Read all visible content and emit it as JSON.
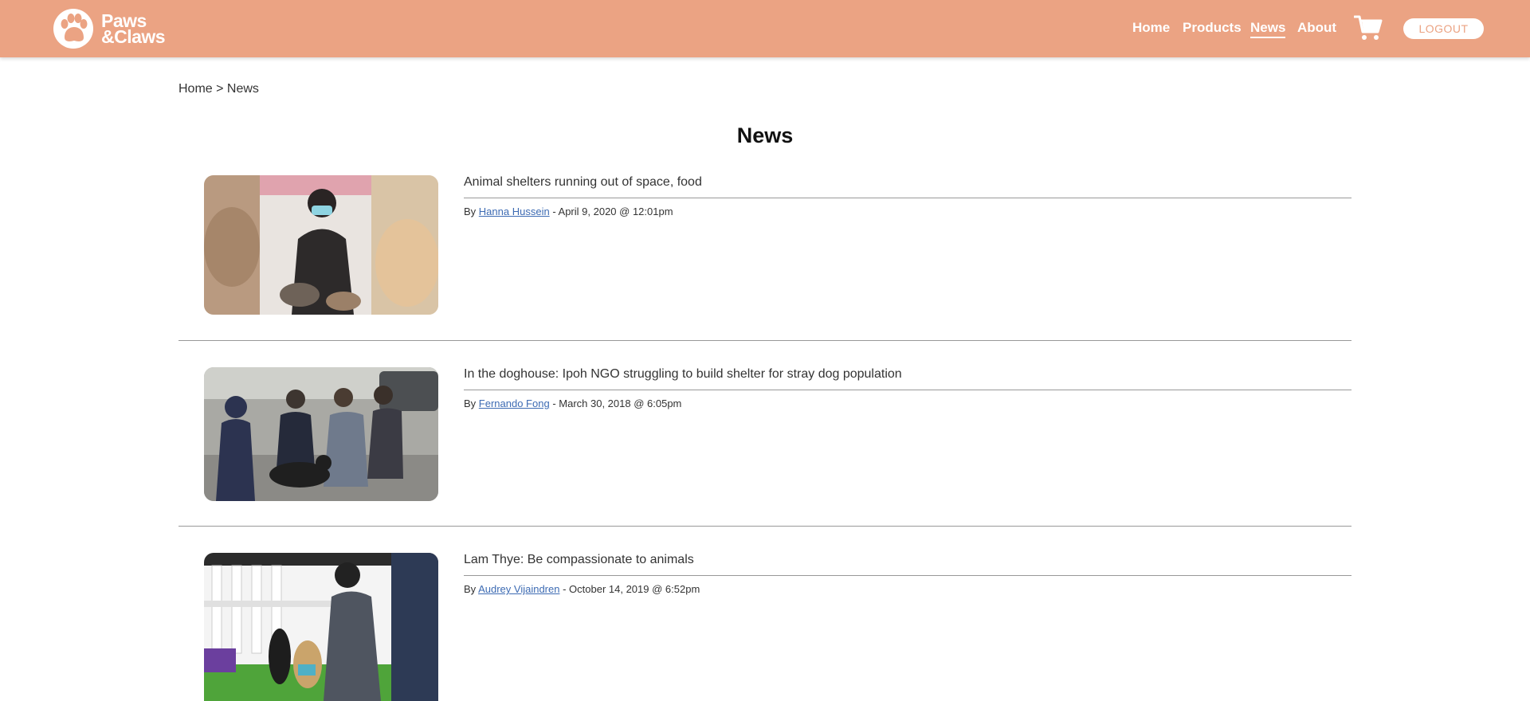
{
  "brand": {
    "line1": "Paws",
    "line2": "&Claws"
  },
  "nav": {
    "home": "Home",
    "products": "Products",
    "news": "News",
    "about": "About",
    "cart_icon": "cart-icon",
    "logout": "LOGOUT"
  },
  "colors": {
    "header": "#eba383",
    "link": "#3d6bb3"
  },
  "breadcrumb": "Home > News",
  "page_title": "News",
  "articles": [
    {
      "title": "Animal shelters running out of space, food",
      "by": "By",
      "author": "Hanna Hussein",
      "date": "- April 9, 2020 @ 12:01pm"
    },
    {
      "title": "In the doghouse: Ipoh NGO struggling to build shelter for stray dog population",
      "by": "By",
      "author": "Fernando Fong",
      "date": "- March 30, 2018 @ 6:05pm"
    },
    {
      "title": "Lam Thye: Be compassionate to animals",
      "by": "By",
      "author": "Audrey Vijaindren",
      "date": "- October 14, 2019 @ 6:52pm"
    }
  ]
}
